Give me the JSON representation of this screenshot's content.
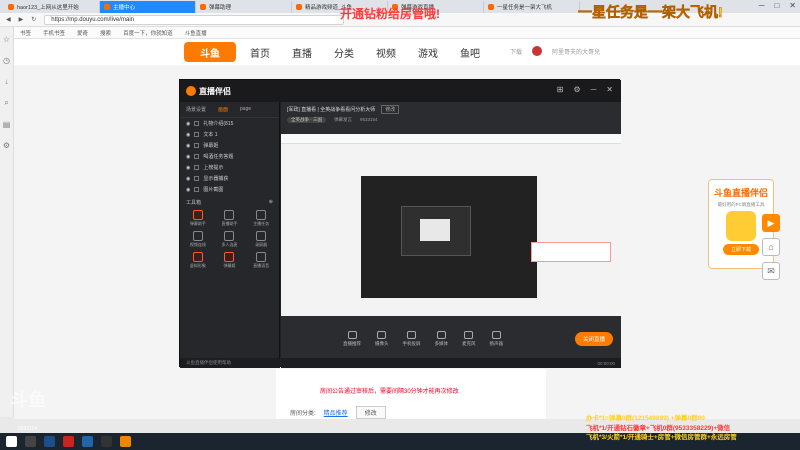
{
  "browser": {
    "tabs": [
      {
        "label": "haor123_上网从这里开始",
        "active": false
      },
      {
        "label": "主播中心",
        "active": true
      },
      {
        "label": "弹幕助理",
        "active": false
      },
      {
        "label": "精品游戏频道_斗鱼",
        "active": false
      },
      {
        "label": "弹幕游戏直播",
        "active": false
      },
      {
        "label": "一星任务是一架大飞机",
        "active": false
      }
    ],
    "url": "https://mp.douyu.com/live/main",
    "bookmarks": [
      "书签",
      "手机书签",
      "爱奇",
      "搜索",
      "百度一下，你就知道",
      "斗鱼直播"
    ],
    "window_controls": [
      "─",
      "□",
      "✕"
    ]
  },
  "overlays": {
    "top_red": "开通钻粉给房管哦!",
    "top_yellow": "一星任务是一架大飞机!"
  },
  "site": {
    "logo": "斗鱼",
    "nav": [
      "首页",
      "直播",
      "分类",
      "视频",
      "游戏",
      "鱼吧"
    ],
    "header_right": {
      "download": "下载",
      "user": "阿里哥夫的大哥兒"
    }
  },
  "form": {
    "notice": "房间公告通过审核后，需要间隔30分钟才能再次修改",
    "category_label": "房间分类:",
    "category_value": "精品推荐",
    "category_button": "修改"
  },
  "promo": {
    "title": "斗鱼直播伴侣",
    "subtitle": "最好用的PC端直播工具",
    "button": "立即下载"
  },
  "float_buttons": [
    "▶",
    "⌂",
    "✉"
  ],
  "tool_app": {
    "title": "直播伴侣",
    "left_tabs": [
      "场景设置",
      "画面",
      "page"
    ],
    "layers": [
      "礼物介绍(815",
      "文本 1",
      "弹幕姬",
      "喝酒任务答题",
      "上榜提示",
      "显示器捕获",
      "图片截图"
    ],
    "tools_header": "工具箱",
    "tools": [
      {
        "label": "弹幕助手",
        "highlight": true
      },
      {
        "label": "直播助手",
        "highlight": false
      },
      {
        "label": "主播任务",
        "highlight": false
      },
      {
        "label": "视频连线",
        "highlight": false
      },
      {
        "label": "多人连麦",
        "highlight": false
      },
      {
        "label": "录屏器",
        "highlight": false
      },
      {
        "label": "虚拟形象",
        "highlight": true
      },
      {
        "label": "弹幕姬",
        "highlight": true
      },
      {
        "label": "直播语音",
        "highlight": false
      }
    ],
    "footer": "斗鱼直播伴侣使用帮助",
    "room_title": "[军政] 直播看 | 全英战争看看问分析大师",
    "room_tag": "修改",
    "room_sub": [
      "全英战争 · 三国",
      "弹幕发言",
      "9533154"
    ],
    "controls": [
      "直播推荐",
      "摄像头",
      "手机投屏",
      "多媒体",
      "麦克风",
      "扬声器"
    ],
    "start_button": "关闭直播",
    "status": "00:00:00"
  },
  "watermark": "斗鱼",
  "watermark_id": "9533154",
  "bottom_ad": [
    {
      "text": "办卡*1=弹幕0群(121549899) +弹幕0群00",
      "color": "#ffd21e"
    },
    {
      "text": "飞机*1/开通钻石徽章+飞机0群(9533358229)+微信",
      "color": "#ff3a3a"
    },
    {
      "text": "飞机*3/火箭*1/开通骑士+房管+微信房管群+永远房管",
      "color": "#ffd21e"
    }
  ]
}
